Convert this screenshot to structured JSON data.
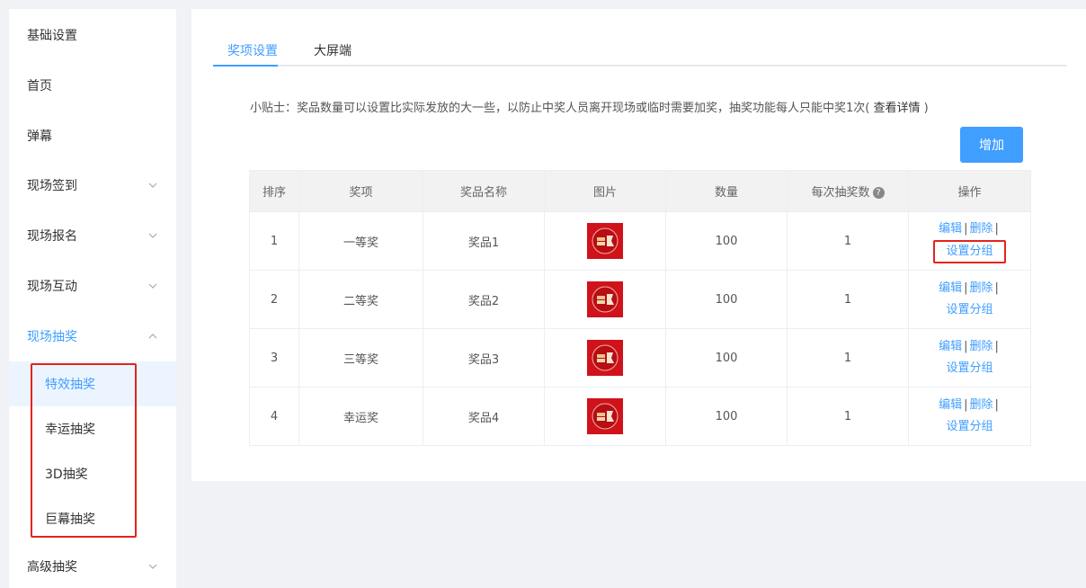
{
  "sidebar": {
    "items": [
      {
        "label": "基础设置",
        "has_chevron": false
      },
      {
        "label": "首页",
        "has_chevron": false
      },
      {
        "label": "弹幕",
        "has_chevron": false
      },
      {
        "label": "现场签到",
        "has_chevron": true
      },
      {
        "label": "现场报名",
        "has_chevron": true
      },
      {
        "label": "现场互动",
        "has_chevron": true
      },
      {
        "label": "现场抽奖",
        "has_chevron": true,
        "expanded": true
      },
      {
        "label": "高级抽奖",
        "has_chevron": true
      }
    ],
    "sub_items": [
      {
        "label": "特效抽奖",
        "active": true
      },
      {
        "label": "幸运抽奖"
      },
      {
        "label": "3D抽奖"
      },
      {
        "label": "巨幕抽奖"
      }
    ]
  },
  "tabs": [
    {
      "label": "奖项设置",
      "active": true
    },
    {
      "label": "大屏端"
    }
  ],
  "tip": {
    "text": "小贴士：奖品数量可以设置比实际发放的大一些，以防止中奖人员离开现场或临时需要加奖，抽奖功能每人只能中奖1次(",
    "link": "查看详情",
    "end": ")"
  },
  "add_button": "增加",
  "table": {
    "headers": [
      "排序",
      "奖项",
      "奖品名称",
      "图片",
      "数量",
      "每次抽奖数",
      "操作"
    ],
    "help_icon": "?",
    "rows": [
      {
        "order": "1",
        "award": "一等奖",
        "prize": "奖品1",
        "qty": "100",
        "per_draw": "1"
      },
      {
        "order": "2",
        "award": "二等奖",
        "prize": "奖品2",
        "qty": "100",
        "per_draw": "1"
      },
      {
        "order": "3",
        "award": "三等奖",
        "prize": "奖品3",
        "qty": "100",
        "per_draw": "1"
      },
      {
        "order": "4",
        "award": "幸运奖",
        "prize": "奖品4",
        "qty": "100",
        "per_draw": "1"
      }
    ],
    "ops": {
      "edit": "编辑",
      "delete": "删除",
      "sep": "|",
      "group": "设置分组"
    }
  },
  "colors": {
    "accent": "#409eff",
    "highlight": "#e4231b",
    "prize_red": "#d0121b"
  }
}
